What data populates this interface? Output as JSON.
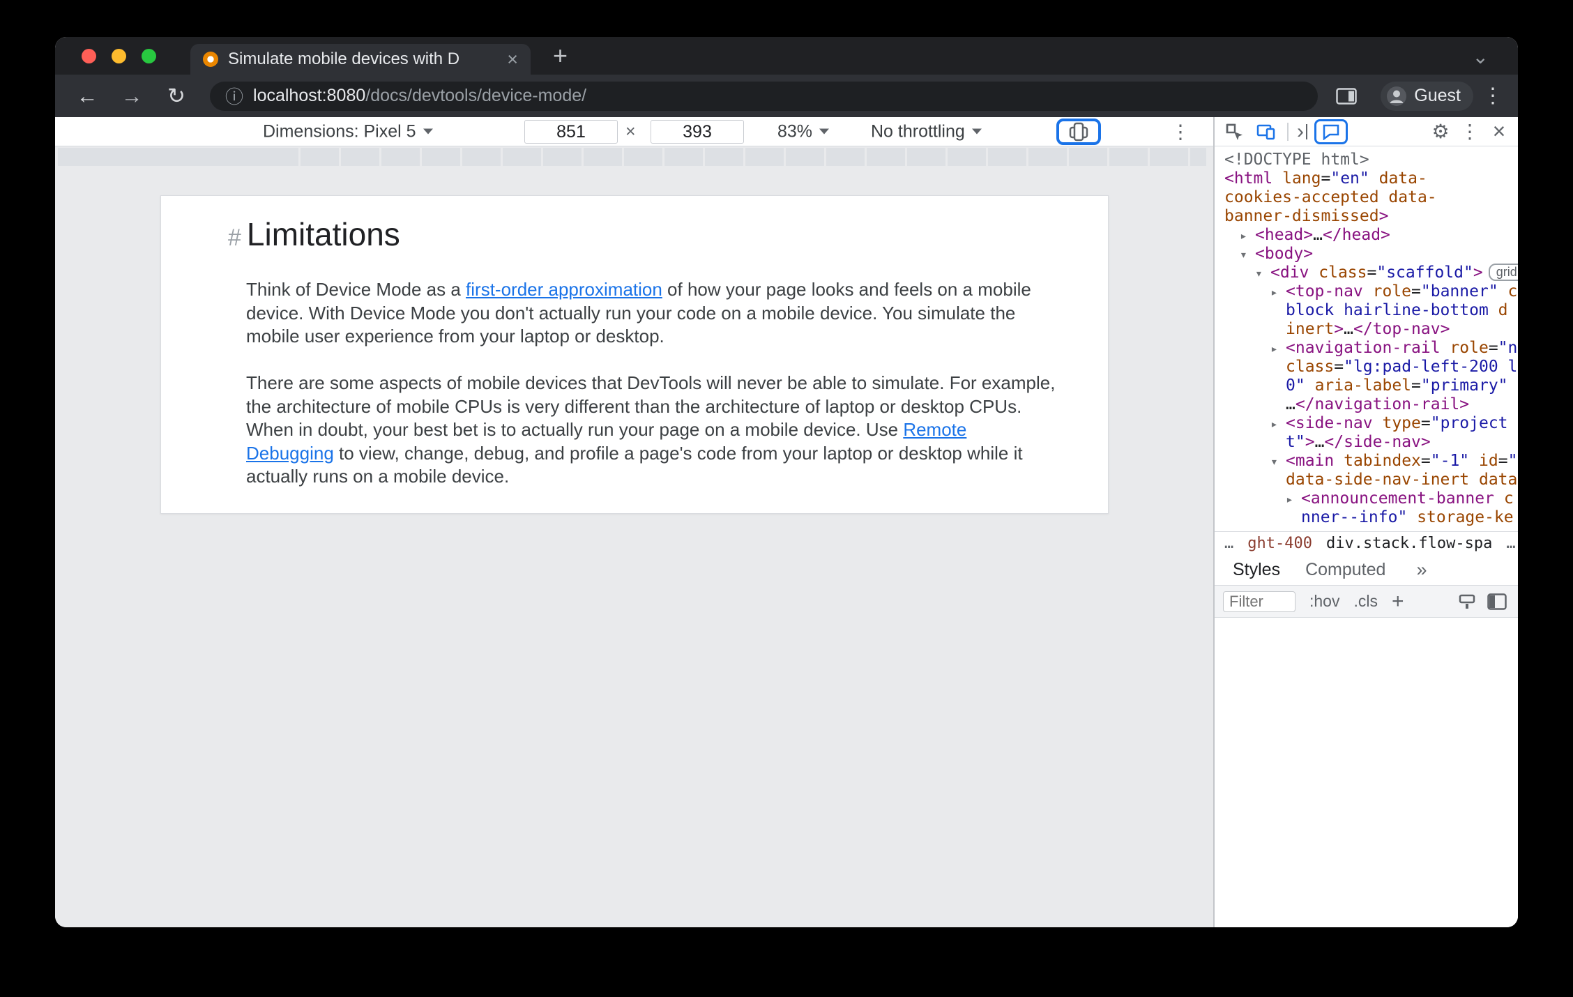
{
  "colors": {
    "accent_blue": "#1a73e8",
    "highlight_ring": "#1a73e8",
    "tag_purple": "#881280",
    "attr_orange": "#994500",
    "value_blue": "#1a1aa6",
    "link_blue": "#1a73e8"
  },
  "tabbar": {
    "tab_title": "Simulate mobile devices with D",
    "close_glyph": "×",
    "new_tab_glyph": "+",
    "chevron_glyph": "⌄"
  },
  "toolbar": {
    "back_glyph": "←",
    "forward_glyph": "→",
    "reload_glyph": "↻",
    "info_glyph": "ⓘ",
    "url_host": "localhost:8080",
    "url_path": "/docs/devtools/device-mode/",
    "guest_label": "Guest",
    "kebab_glyph": "⋮"
  },
  "device_toolbar": {
    "dimensions_label": "Dimensions: Pixel 5",
    "width_value": "851",
    "times_glyph": "×",
    "height_value": "393",
    "zoom_value": "83%",
    "throttling_value": "No throttling",
    "kebab_glyph": "⋮"
  },
  "page": {
    "heading_hash": "#",
    "heading": "Limitations",
    "paragraphs": [
      {
        "parts": [
          {
            "t": "Think of Device Mode as a "
          },
          {
            "t": "first-order approximation",
            "link": true
          },
          {
            "t": " of how your page looks and feels on a mobile device. With Device Mode you don't actually run your code on a mobile device. You simulate the mobile user experience from your laptop or desktop."
          }
        ]
      },
      {
        "parts": [
          {
            "t": "There are some aspects of mobile devices that DevTools will never be able to simulate. For example, the architecture of mobile CPUs is very different than the architecture of laptop or desktop CPUs. When in doubt, your best bet is to actually run your page on a mobile device. Use "
          },
          {
            "t": "Remote Debugging",
            "link": true
          },
          {
            "t": " to view, change, debug, and profile a page's code from your laptop or desktop while it actually runs on a mobile device."
          }
        ]
      }
    ]
  },
  "devtools": {
    "gear_glyph": "⚙",
    "kebab_glyph": "⋮",
    "close_glyph": "×",
    "chevron_glyph": "›",
    "tree_lines": [
      {
        "ind": 14,
        "segs": [
          {
            "c": "doc",
            "t": "<!DOCTYPE html>"
          }
        ]
      },
      {
        "ind": 14,
        "segs": [
          {
            "c": "tag",
            "t": "<html"
          },
          {
            "c": "txt",
            "t": " "
          },
          {
            "c": "attr",
            "t": "lang"
          },
          {
            "c": "txt",
            "t": "="
          },
          {
            "c": "val",
            "t": "\"en\""
          },
          {
            "c": "txt",
            "t": " "
          },
          {
            "c": "attr",
            "t": "data-"
          }
        ]
      },
      {
        "ind": 14,
        "segs": [
          {
            "c": "attr",
            "t": "cookies-accepted"
          },
          {
            "c": "txt",
            "t": " "
          },
          {
            "c": "attr",
            "t": "data-"
          }
        ]
      },
      {
        "ind": 14,
        "segs": [
          {
            "c": "attr",
            "t": "banner-dismissed"
          },
          {
            "c": "tag",
            "t": ">"
          }
        ]
      },
      {
        "ind": 58,
        "arrow": "▸",
        "segs": [
          {
            "c": "tag",
            "t": "<head>"
          },
          {
            "c": "txt",
            "t": "…"
          },
          {
            "c": "tag",
            "t": "</head>"
          }
        ]
      },
      {
        "ind": 58,
        "arrow": "▾",
        "segs": [
          {
            "c": "tag",
            "t": "<body>"
          }
        ]
      },
      {
        "ind": 80,
        "arrow": "▾",
        "segs": [
          {
            "c": "tag",
            "t": "<div"
          },
          {
            "c": "txt",
            "t": " "
          },
          {
            "c": "attr",
            "t": "class"
          },
          {
            "c": "txt",
            "t": "="
          },
          {
            "c": "val",
            "t": "\"scaffold\""
          },
          {
            "c": "tag",
            "t": ">"
          },
          {
            "c": "badge",
            "t": "grid"
          }
        ]
      },
      {
        "ind": 102,
        "arrow": "▸",
        "segs": [
          {
            "c": "tag",
            "t": "<top-nav"
          },
          {
            "c": "txt",
            "t": " "
          },
          {
            "c": "attr",
            "t": "role"
          },
          {
            "c": "txt",
            "t": "="
          },
          {
            "c": "val",
            "t": "\"banner\""
          },
          {
            "c": "txt",
            "t": " "
          },
          {
            "c": "attr",
            "t": "c"
          }
        ]
      },
      {
        "ind": 102,
        "segs": [
          {
            "c": "val",
            "t": "block hairline-bottom"
          },
          {
            "c": "txt",
            "t": " "
          },
          {
            "c": "attr",
            "t": "d"
          }
        ]
      },
      {
        "ind": 102,
        "segs": [
          {
            "c": "attr",
            "t": "inert"
          },
          {
            "c": "tag",
            "t": ">"
          },
          {
            "c": "txt",
            "t": "…"
          },
          {
            "c": "tag",
            "t": "</top-nav>"
          }
        ]
      },
      {
        "ind": 102,
        "arrow": "▸",
        "segs": [
          {
            "c": "tag",
            "t": "<navigation-rail"
          },
          {
            "c": "txt",
            "t": " "
          },
          {
            "c": "attr",
            "t": "role"
          },
          {
            "c": "txt",
            "t": "="
          },
          {
            "c": "val",
            "t": "\"n"
          }
        ]
      },
      {
        "ind": 102,
        "segs": [
          {
            "c": "attr",
            "t": "class"
          },
          {
            "c": "txt",
            "t": "="
          },
          {
            "c": "val",
            "t": "\"lg:pad-left-200 l"
          }
        ]
      },
      {
        "ind": 102,
        "segs": [
          {
            "c": "val",
            "t": "0\""
          },
          {
            "c": "txt",
            "t": " "
          },
          {
            "c": "attr",
            "t": "aria-label"
          },
          {
            "c": "txt",
            "t": "="
          },
          {
            "c": "val",
            "t": "\"primary\""
          }
        ]
      },
      {
        "ind": 102,
        "segs": [
          {
            "c": "txt",
            "t": "…"
          },
          {
            "c": "tag",
            "t": "</navigation-rail>"
          }
        ]
      },
      {
        "ind": 102,
        "arrow": "▸",
        "segs": [
          {
            "c": "tag",
            "t": "<side-nav"
          },
          {
            "c": "txt",
            "t": " "
          },
          {
            "c": "attr",
            "t": "type"
          },
          {
            "c": "txt",
            "t": "="
          },
          {
            "c": "val",
            "t": "\"project"
          }
        ]
      },
      {
        "ind": 102,
        "segs": [
          {
            "c": "val",
            "t": "t\""
          },
          {
            "c": "tag",
            "t": ">"
          },
          {
            "c": "txt",
            "t": "…"
          },
          {
            "c": "tag",
            "t": "</side-nav>"
          }
        ]
      },
      {
        "ind": 102,
        "arrow": "▾",
        "segs": [
          {
            "c": "tag",
            "t": "<main"
          },
          {
            "c": "txt",
            "t": " "
          },
          {
            "c": "attr",
            "t": "tabindex"
          },
          {
            "c": "txt",
            "t": "="
          },
          {
            "c": "val",
            "t": "\"-1\""
          },
          {
            "c": "txt",
            "t": " "
          },
          {
            "c": "attr",
            "t": "id"
          },
          {
            "c": "txt",
            "t": "="
          },
          {
            "c": "val",
            "t": "\""
          }
        ]
      },
      {
        "ind": 102,
        "segs": [
          {
            "c": "attr",
            "t": "data-side-nav-inert"
          },
          {
            "c": "txt",
            "t": " "
          },
          {
            "c": "attr",
            "t": "data"
          }
        ]
      },
      {
        "ind": 124,
        "arrow": "▸",
        "segs": [
          {
            "c": "tag",
            "t": "<announcement-banner"
          },
          {
            "c": "txt",
            "t": " "
          },
          {
            "c": "attr",
            "t": "c"
          }
        ]
      },
      {
        "ind": 124,
        "segs": [
          {
            "c": "val",
            "t": "nner--info\""
          },
          {
            "c": "txt",
            "t": " "
          },
          {
            "c": "attr",
            "t": "storage-ke"
          }
        ]
      }
    ],
    "breadcrumbs": {
      "left_ellipsis": "…",
      "crumb_a": "ght-400",
      "crumb_b": "div.stack.flow-spa",
      "right_ellipsis": "…"
    },
    "tabs": {
      "styles": "Styles",
      "computed": "Computed",
      "more": "»"
    },
    "filter_bar": {
      "placeholder": "Filter",
      "hov": ":hov",
      "cls": ".cls",
      "plus": "+"
    }
  }
}
